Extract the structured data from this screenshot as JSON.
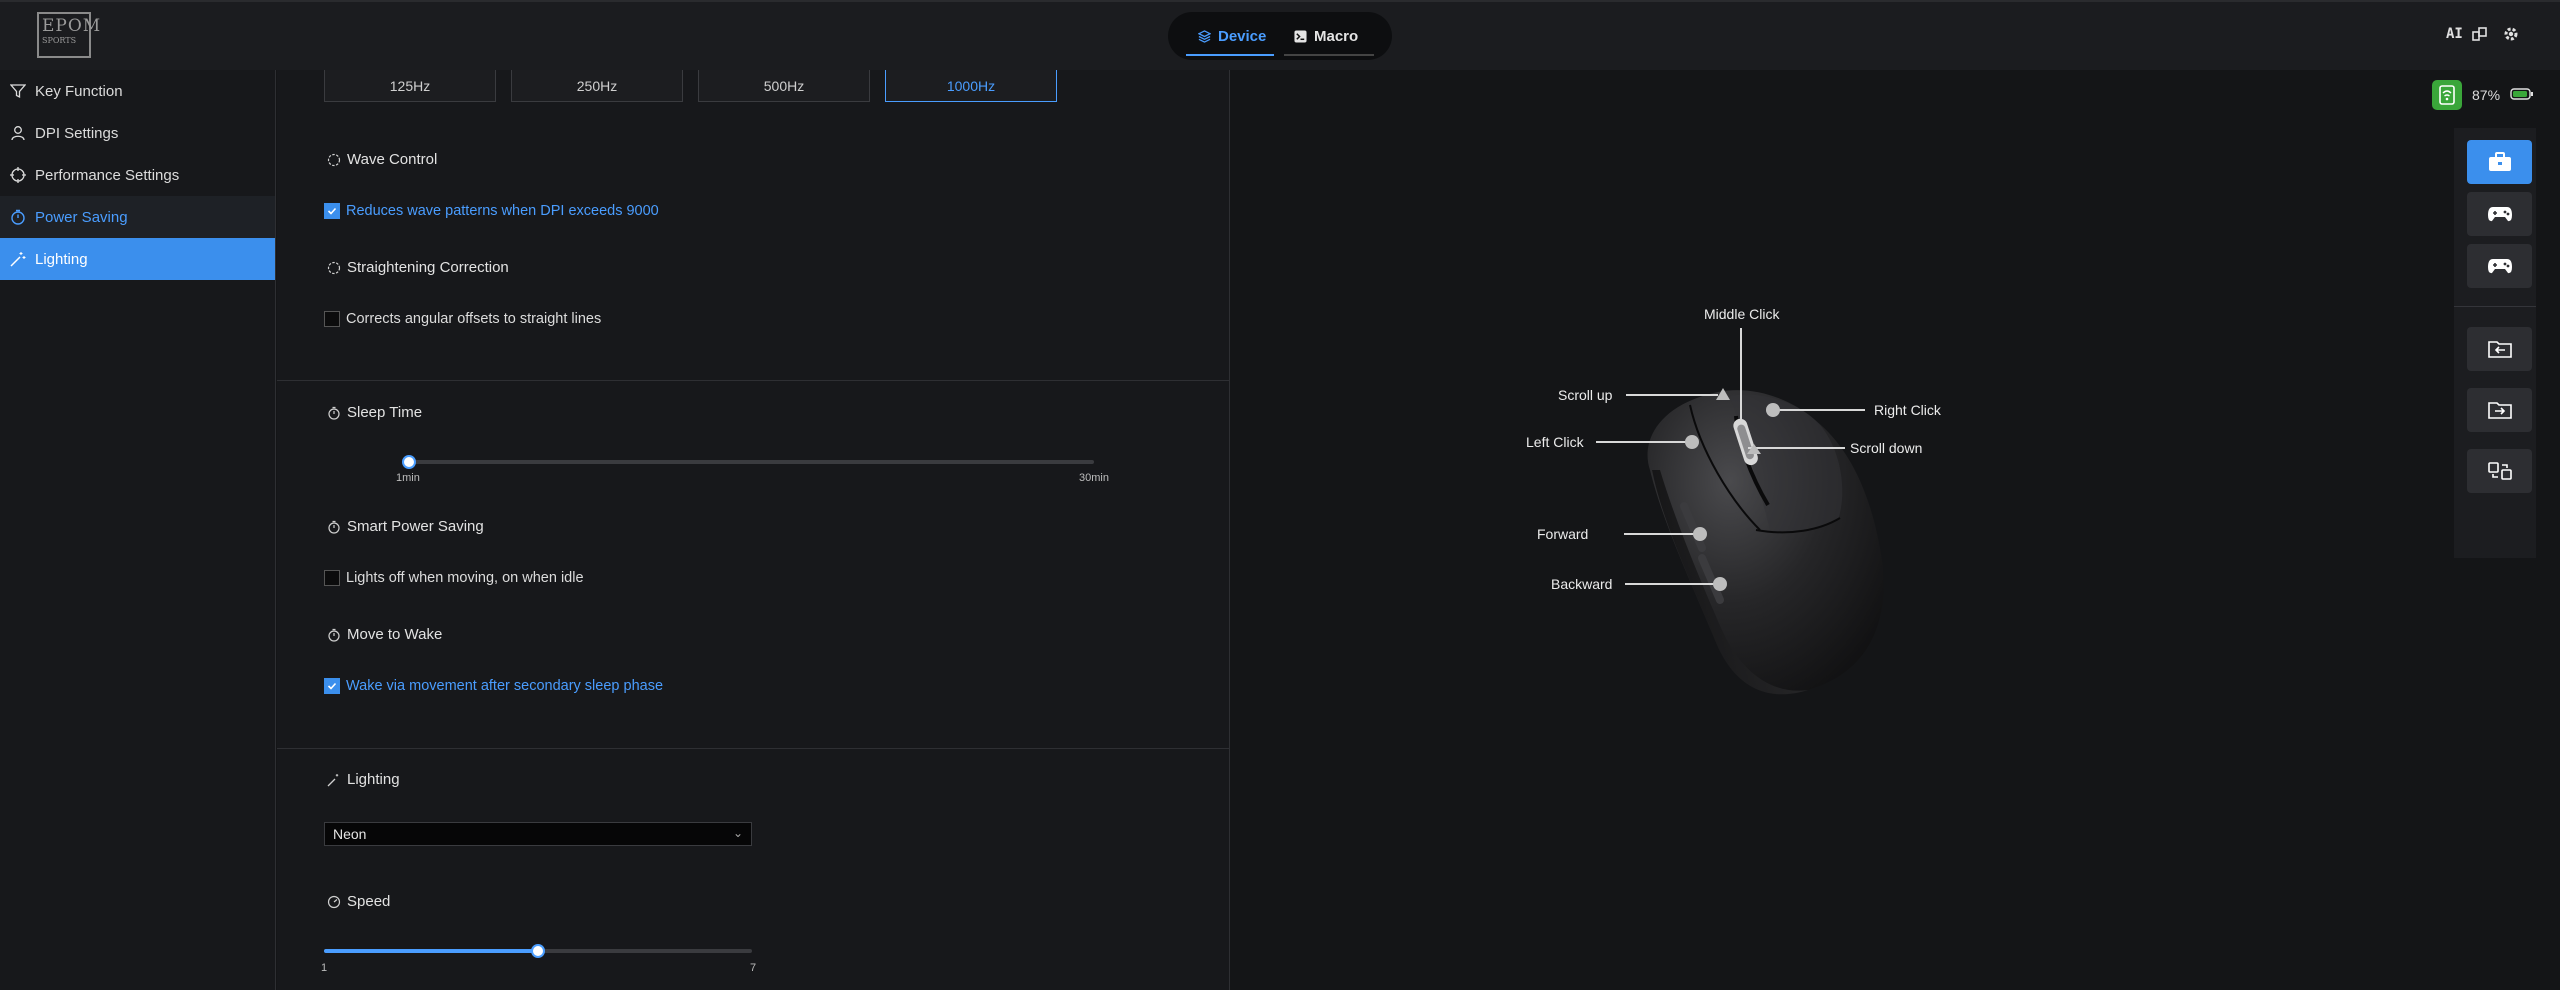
{
  "topbar": {
    "logo_main": "EPOM",
    "logo_sub": "SPORTS",
    "tabs": [
      {
        "label": "Device",
        "active": true
      },
      {
        "label": "Macro",
        "active": false
      }
    ],
    "ai_label": "AI"
  },
  "sidebar": {
    "items": [
      {
        "label": "Key Function",
        "icon": "filter-icon",
        "state": "normal"
      },
      {
        "label": "DPI Settings",
        "icon": "user-icon",
        "state": "normal"
      },
      {
        "label": "Performance Settings",
        "icon": "crosshair-icon",
        "state": "normal"
      },
      {
        "label": "Power Saving",
        "icon": "timer-icon",
        "state": "selected"
      },
      {
        "label": "Lighting",
        "icon": "magic-wand-icon",
        "state": "active"
      }
    ]
  },
  "polling": {
    "options": [
      "125Hz",
      "250Hz",
      "500Hz",
      "1000Hz"
    ],
    "selected": "1000Hz"
  },
  "wave_control": {
    "title": "Wave Control",
    "checkbox_label": "Reduces wave patterns when DPI exceeds 9000",
    "checked": true
  },
  "straightening": {
    "title": "Straightening Correction",
    "checkbox_label": "Corrects angular offsets to straight lines",
    "checked": false
  },
  "sleep_time": {
    "title": "Sleep Time",
    "min_label": "1min",
    "max_label": "30min",
    "value_fraction": 0.0
  },
  "smart_power": {
    "title": "Smart Power Saving",
    "checkbox_label": "Lights off when moving, on when idle",
    "checked": false
  },
  "move_to_wake": {
    "title": "Move to Wake",
    "checkbox_label": "Wake via movement after secondary sleep phase",
    "checked": true
  },
  "lighting": {
    "title": "Lighting",
    "mode": "Neon",
    "speed_title": "Speed",
    "speed_min": "1",
    "speed_max": "7",
    "speed_value_fraction": 0.5
  },
  "status": {
    "battery_percent": "87%",
    "accent_color": "#3b8fed",
    "battery_color": "#3aa63a"
  },
  "mouse_labels": {
    "middle_click": "Middle Click",
    "scroll_up": "Scroll up",
    "right_click": "Right Click",
    "left_click": "Left Click",
    "scroll_down": "Scroll down",
    "forward": "Forward",
    "backward": "Backward"
  }
}
